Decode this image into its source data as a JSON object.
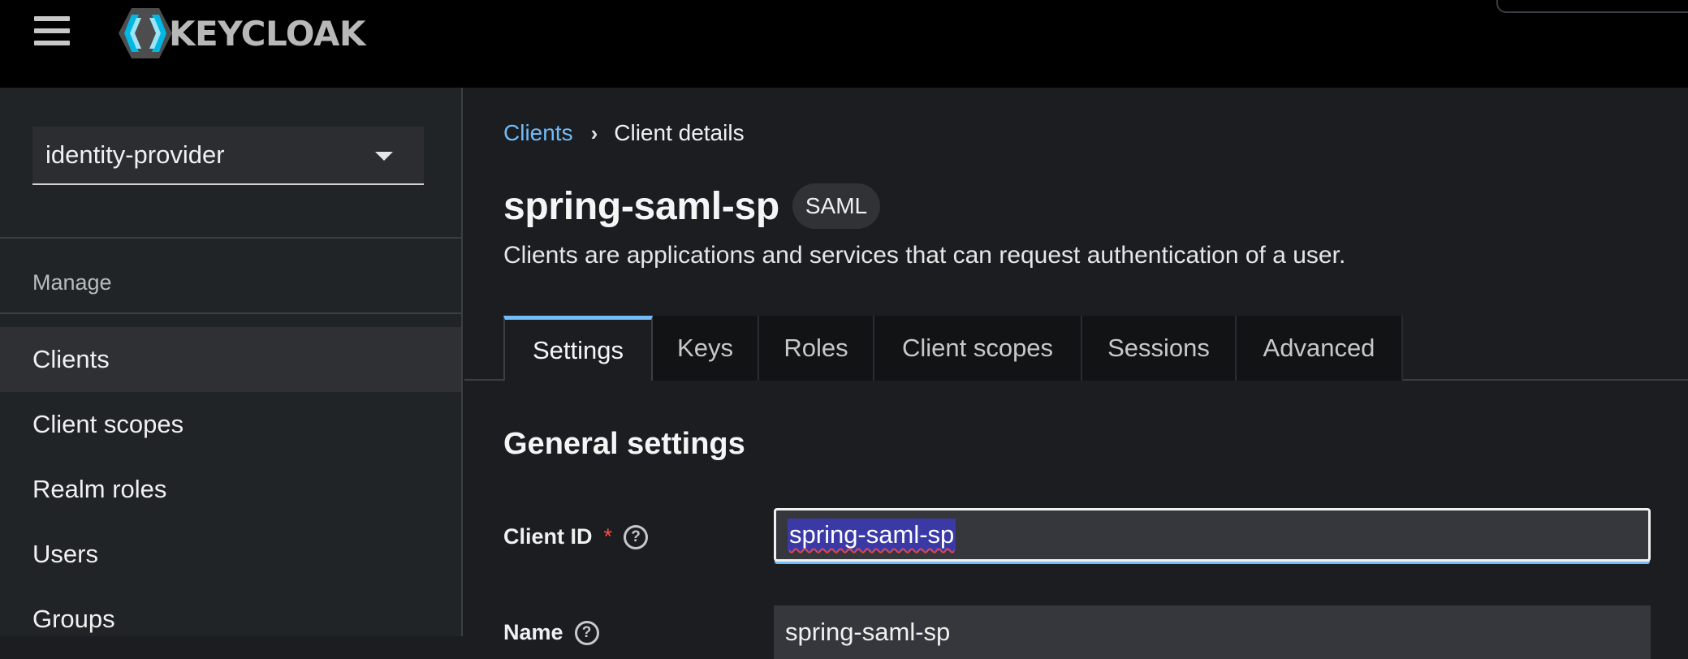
{
  "app": {
    "logo_text": "KEYCLOAK"
  },
  "sidebar": {
    "realm": "identity-provider",
    "section": "Manage",
    "items": [
      {
        "label": "Clients",
        "active": true
      },
      {
        "label": "Client scopes",
        "active": false
      },
      {
        "label": "Realm roles",
        "active": false
      },
      {
        "label": "Users",
        "active": false
      },
      {
        "label": "Groups",
        "active": false
      }
    ]
  },
  "breadcrumb": {
    "parent": "Clients",
    "current": "Client details"
  },
  "header": {
    "title": "spring-saml-sp",
    "badge": "SAML",
    "subtitle": "Clients are applications and services that can request authentication of a user."
  },
  "tabs": [
    {
      "label": "Settings",
      "active": true
    },
    {
      "label": "Keys",
      "active": false
    },
    {
      "label": "Roles",
      "active": false
    },
    {
      "label": "Client scopes",
      "active": false
    },
    {
      "label": "Sessions",
      "active": false
    },
    {
      "label": "Advanced",
      "active": false
    }
  ],
  "form": {
    "section_title": "General settings",
    "client_id_label": "Client ID",
    "required_mark": "*",
    "help_symbol": "?",
    "client_id_value": "spring-saml-sp",
    "name_label": "Name",
    "name_value": "spring-saml-sp"
  },
  "colors": {
    "accent": "#73bcf7",
    "masthead": "#000000",
    "sidebar_bg": "#212427",
    "main_bg": "#1b1d21",
    "selection": "#3a39a5",
    "required": "#ff4d4d"
  }
}
